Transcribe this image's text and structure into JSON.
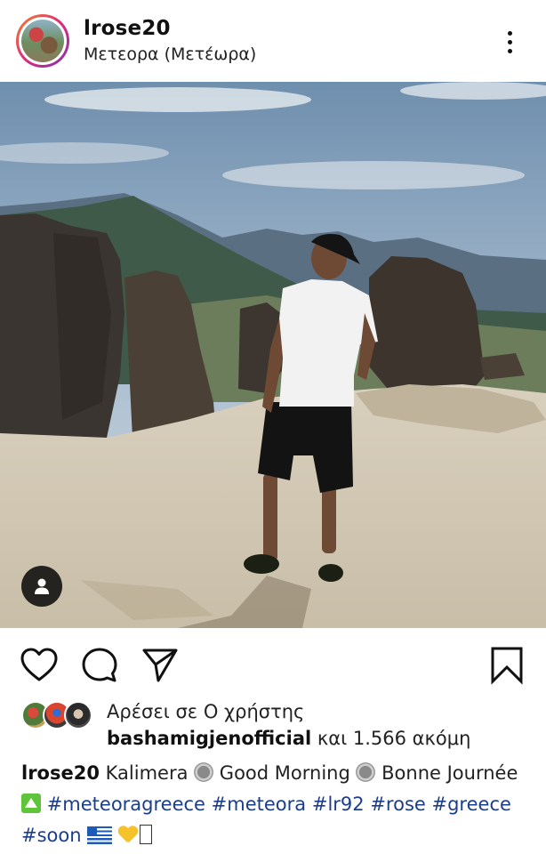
{
  "post": {
    "username": "lrose20",
    "location": "Μετεορα (Μετέωρα)",
    "avatar_icon": "profile-photo",
    "more_icon": "more-vertical-icon"
  },
  "photo": {
    "user_tag_icon": "person-icon"
  },
  "actions": {
    "like_icon": "heart-icon",
    "comment_icon": "comment-icon",
    "share_icon": "paper-plane-icon",
    "save_icon": "bookmark-icon"
  },
  "likes": {
    "line1": "Αρέσει σε Ο χρήστης",
    "top_liker": "bashamigjenofficial",
    "rest": " και 1.566 ακόμη"
  },
  "caption": {
    "username": "lrose20",
    "t1": " Kalimera ",
    "t2": " Good Morning ",
    "t3": " Bonne Journée ",
    "tag1": "#meteoragreece",
    "tag2": "#meteora",
    "tag3": "#lr92",
    "tag4": "#rose",
    "tag5": "#greece",
    "tag6": "#soon"
  },
  "colors": {
    "hashtag": "#1b3e8c",
    "story_ring": "#dd2a7b"
  }
}
